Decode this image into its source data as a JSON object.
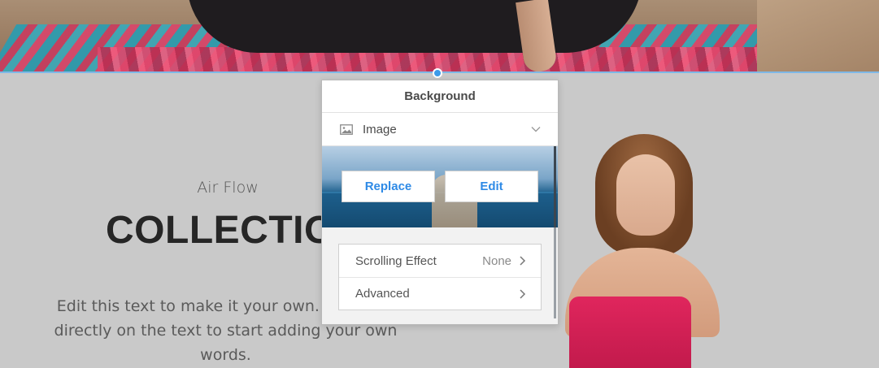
{
  "hero": {
    "description_icon": "hero-photo"
  },
  "text_block": {
    "subtitle": "Air Flow",
    "title": "COLLECTIO",
    "body": "Edit this text to make it your own. To e click directly on the text to start adding your own words."
  },
  "panel": {
    "title": "Background",
    "type_icon": "image-icon",
    "type_label": "Image",
    "replace_label": "Replace",
    "edit_label": "Edit",
    "settings": [
      {
        "label": "Scrolling Effect",
        "value": "None"
      },
      {
        "label": "Advanced",
        "value": ""
      }
    ]
  },
  "colors": {
    "accent": "#2e8ae6",
    "selection_line": "#7fb8e6",
    "handle": "#3d9be9",
    "page_bg": "#c9c9c9"
  }
}
